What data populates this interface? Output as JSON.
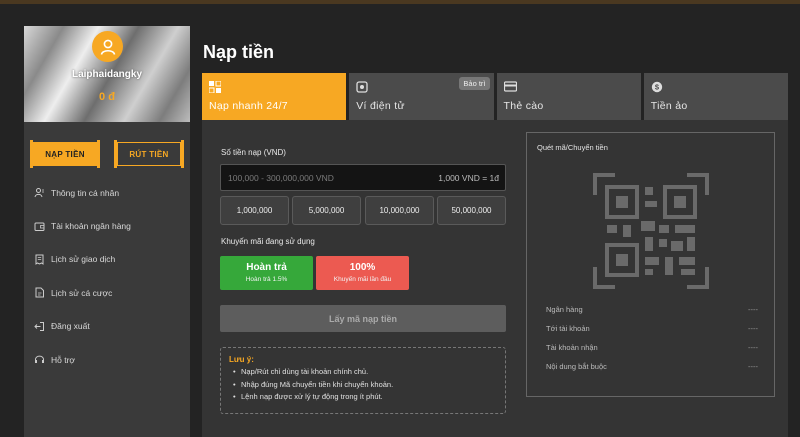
{
  "colors": {
    "accent": "#f7a823",
    "background": "#232323",
    "green": "#36a83a",
    "red": "#ec5a51"
  },
  "sidebar": {
    "username": "Laiphaidangky",
    "balance": "0 đ",
    "deposit_label": "NẠP TIỀN",
    "withdraw_label": "RÚT TIỀN",
    "menu": [
      {
        "label": "Thông tin cá nhân",
        "icon": "user-icon"
      },
      {
        "label": "Tài khoản ngân hàng",
        "icon": "wallet-icon"
      },
      {
        "label": "Lịch sử giao dịch",
        "icon": "receipt-icon"
      },
      {
        "label": "Lịch sử cá cược",
        "icon": "document-icon"
      },
      {
        "label": "Đăng xuất",
        "icon": "logout-icon"
      },
      {
        "label": "Hỗ trợ",
        "icon": "headset-icon"
      }
    ]
  },
  "page": {
    "title": "Nạp tiền"
  },
  "tabs": [
    {
      "label": "Nạp nhanh 24/7",
      "icon": "qr-icon",
      "active": true
    },
    {
      "label": "Ví điện tử",
      "icon": "ewallet-icon",
      "badge": "Bảo trì"
    },
    {
      "label": "Thẻ cào",
      "icon": "card-icon"
    },
    {
      "label": "Tiền ảo",
      "icon": "coin-icon"
    }
  ],
  "form": {
    "amount_label": "Số tiền nạp (VND)",
    "amount_placeholder": "100,000 - 300,000,000 VND",
    "rate": "1,000 VND = 1đ",
    "quick_amounts": [
      "1,000,000",
      "5,000,000",
      "10,000,000",
      "50,000,000"
    ],
    "promo_label": "Khuyến mãi đang sử dụng",
    "promos": [
      {
        "title": "Hoàn trả",
        "subtitle": "Hoàn trả 1.5%"
      },
      {
        "title": "100%",
        "subtitle": "Khuyến mãi lần đầu"
      }
    ],
    "submit_label": "Lấy mã nạp tiền"
  },
  "note": {
    "title": "Lưu ý:",
    "items": [
      "Nạp/Rút chỉ dùng tài khoản chính chủ.",
      "Nhập đúng Mã chuyển tiền khi chuyển khoản.",
      "Lệnh nạp được xử lý tự động trong ít phút."
    ]
  },
  "qr": {
    "title": "Quét mã/Chuyển tiền",
    "rows": [
      {
        "label": "Ngân hàng",
        "value": "----"
      },
      {
        "label": "Tới tài khoản",
        "value": "----"
      },
      {
        "label": "Tài khoản nhận",
        "value": "----"
      },
      {
        "label": "Nội dung bắt buộc",
        "value": "----"
      }
    ]
  }
}
